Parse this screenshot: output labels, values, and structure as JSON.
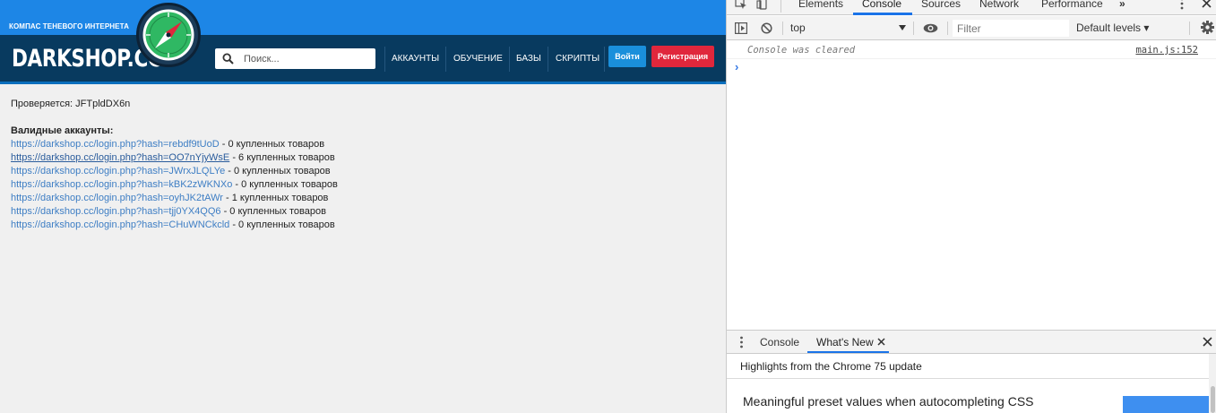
{
  "site": {
    "tagline": "КОМПАС ТЕНЕВОГО ИНТЕРНЕТА",
    "logo": "DARKSHOP.CC",
    "search_placeholder": "Поиск...",
    "nav": [
      "АККАУНТЫ",
      "ОБУЧЕНИЕ",
      "БАЗЫ",
      "СКРИПТЫ"
    ],
    "login_label": "Войти",
    "register_label": "Регистрация",
    "colors": {
      "header_top": "#1d86e6",
      "header_bar": "#083a5f",
      "login": "#1a8fdb",
      "register": "#e0273c",
      "link": "#3e7ec4"
    }
  },
  "content": {
    "checking": "Проверяется: JFTpldDX6n",
    "valid_title": "Валидные аккаунты:",
    "accounts": [
      {
        "url": "https://darkshop.cc/login.php?hash=rebdf9tUoD",
        "suffix": " - 0 купленных товаров"
      },
      {
        "url": "https://darkshop.cc/login.php?hash=OO7nYjyWsE",
        "suffix": " - 6 купленных товаров"
      },
      {
        "url": "https://darkshop.cc/login.php?hash=JWrxJLQLYe",
        "suffix": " - 0 купленных товаров"
      },
      {
        "url": "https://darkshop.cc/login.php?hash=kBK2zWKNXo",
        "suffix": " - 0 купленных товаров"
      },
      {
        "url": "https://darkshop.cc/login.php?hash=oyhJK2tAWr",
        "suffix": " - 1 купленных товаров"
      },
      {
        "url": "https://darkshop.cc/login.php?hash=tjj0YX4QQ6",
        "suffix": " - 0 купленных товаров"
      },
      {
        "url": "https://darkshop.cc/login.php?hash=CHuWNCkcld",
        "suffix": " - 0 купленных товаров"
      }
    ]
  },
  "devtools": {
    "tabs": [
      "Elements",
      "Console",
      "Sources",
      "Network",
      "Performance"
    ],
    "active_tab": "Console",
    "more_tabs": "»",
    "context": "top",
    "filter_placeholder": "Filter",
    "levels": "Default levels ▾",
    "cleared_message": "Console was cleared",
    "cleared_source": "main.js:152",
    "prompt": "›",
    "drawer_tabs": [
      "Console",
      "What's New"
    ],
    "drawer_active": "What's New",
    "highlights": "Highlights from the Chrome 75 update",
    "feature_title": "Meaningful preset values when autocompleting CSS",
    "colors": {
      "accent": "#1a73e8",
      "prompt": "#3578e5",
      "thumb": "#3e8ff0"
    }
  }
}
